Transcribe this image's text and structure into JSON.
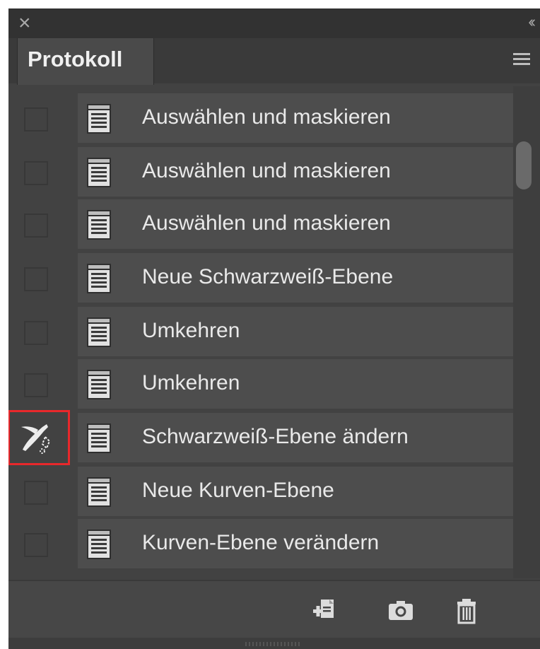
{
  "window": {
    "close_glyph": "×",
    "collapse_glyph": "‹‹"
  },
  "tab": {
    "label": "Protokoll"
  },
  "history": {
    "items": [
      {
        "label": "Auswählen und maskieren",
        "source": false
      },
      {
        "label": "Auswählen und maskieren",
        "source": false
      },
      {
        "label": "Auswählen und maskieren",
        "source": false
      },
      {
        "label": "Neue Schwarzweiß-Ebene",
        "source": false
      },
      {
        "label": "Umkehren",
        "source": false
      },
      {
        "label": "Umkehren",
        "source": false
      },
      {
        "label": "Schwarzweiß-Ebene ändern",
        "source": true
      },
      {
        "label": "Neue Kurven-Ebene",
        "source": false
      },
      {
        "label": "Kurven-Ebene verändern",
        "source": false
      }
    ]
  },
  "footer": {
    "buttons": [
      "new-document-from-state-icon",
      "camera-icon",
      "trash-icon"
    ]
  },
  "colors": {
    "panel": "#424242",
    "row": "#4d4d4d",
    "text": "#e9e9e9",
    "highlight": "#e8282b"
  }
}
